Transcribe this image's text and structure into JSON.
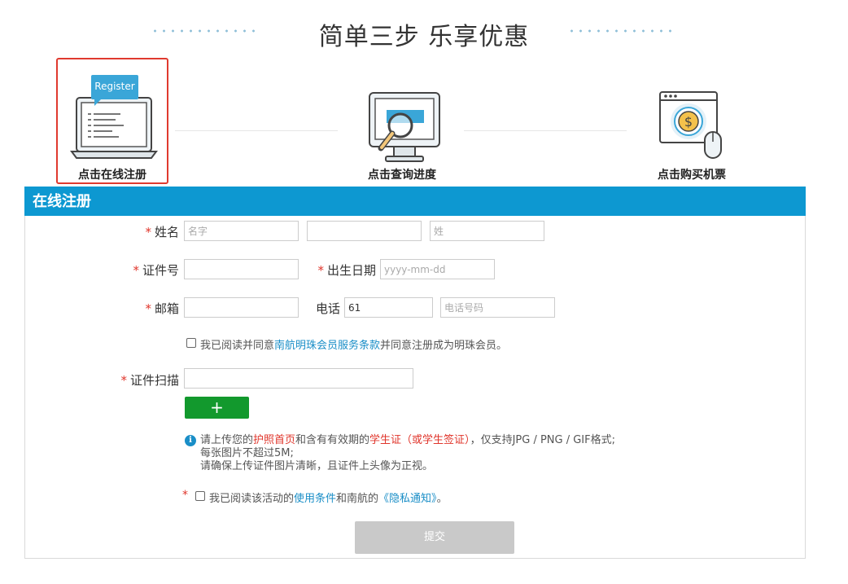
{
  "hero": {
    "title": "简单三步 乐享优惠"
  },
  "steps": [
    {
      "label": "点击在线注册",
      "icon": "laptop-register-icon",
      "badge": "Register"
    },
    {
      "label": "点击查询进度",
      "icon": "monitor-search-icon"
    },
    {
      "label": "点击购买机票",
      "icon": "payment-window-icon"
    }
  ],
  "form": {
    "title": "在线注册",
    "name": {
      "label": "姓名",
      "first_placeholder": "名字",
      "middle_placeholder": "",
      "last_placeholder": "姓"
    },
    "id_number": {
      "label": "证件号",
      "value": ""
    },
    "birthdate": {
      "label": "出生日期",
      "placeholder": "yyyy-mm-dd"
    },
    "email": {
      "label": "邮箱",
      "value": ""
    },
    "phone": {
      "label": "电话",
      "country_code": "61",
      "placeholder": "电话号码"
    },
    "agree_member": {
      "prefix": "我已阅读并同意",
      "link": "南航明珠会员服务条款",
      "suffix": "并同意注册成为明珠会员。"
    },
    "scan": {
      "label": "证件扫描",
      "add_label": "+"
    },
    "info": {
      "line1_a": "请上传您的",
      "line1_b": "护照首页",
      "line1_c": "和含有有效期的",
      "line1_d": "学生证（或学生签证）",
      "line1_e": "，仅支持JPG / PNG / GIF格式;",
      "line2": "每张图片不超过5M;",
      "line3": "请确保上传证件图片清晰，且证件上头像为正视。"
    },
    "agree_terms": {
      "prefix": "我已阅读该活动的",
      "link1": "使用条件",
      "middle": "和南航的",
      "link2": "《隐私通知》",
      "suffix": "。"
    },
    "submit_label": "提交"
  },
  "colors": {
    "accent": "#0d98d1",
    "required": "#e0352b",
    "add_button": "#12992d",
    "link": "#1a8ec7"
  }
}
